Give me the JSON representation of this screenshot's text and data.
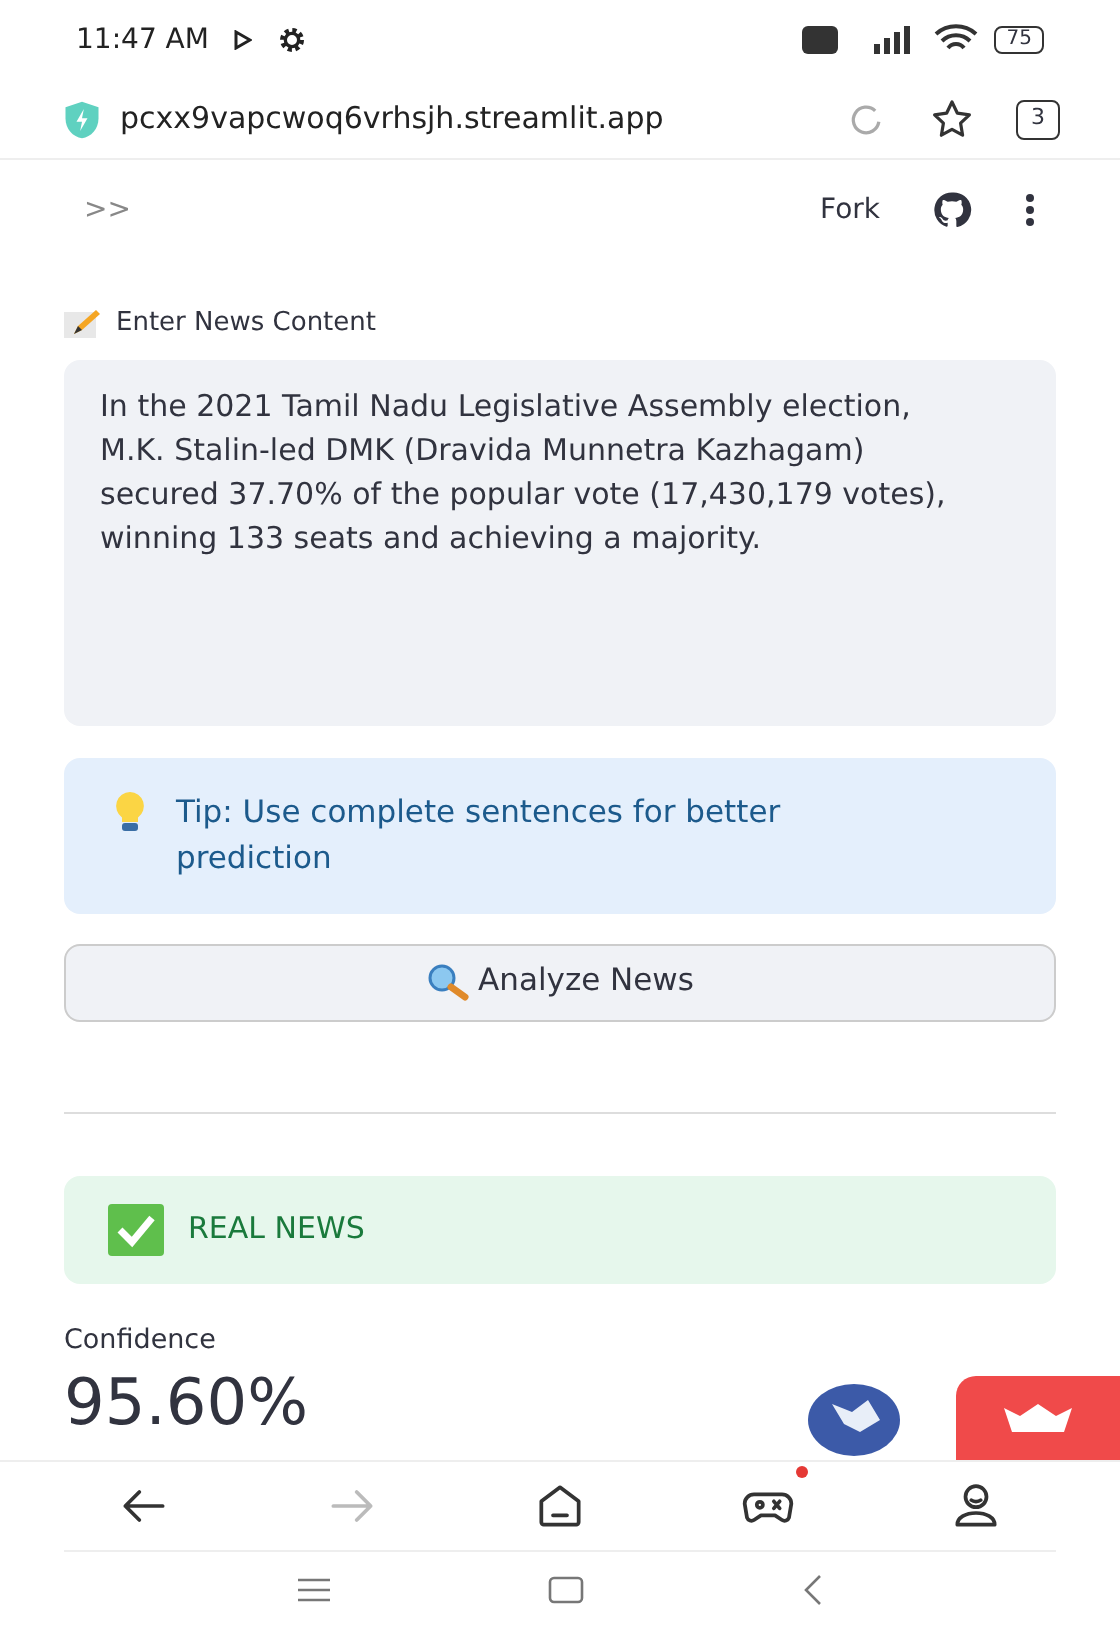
{
  "status_bar": {
    "time": "11:47 AM",
    "battery": "75"
  },
  "browser": {
    "url": "pcxx9vapcwoq6vrhsjh.streamlit.app",
    "tab_count": "3"
  },
  "app_header": {
    "expand": ">>",
    "fork": "Fork"
  },
  "input": {
    "label": "Enter News Content",
    "value": "In the 2021 Tamil Nadu Legislative Assembly election, M.K. Stalin-led DMK (Dravida Munnetra Kazhagam) secured 37.70% of the popular vote (17,430,179 votes), winning 133 seats and achieving a majority."
  },
  "tip": {
    "text": "Tip: Use complete sentences for better prediction"
  },
  "analyze_button": {
    "label": "Analyze News"
  },
  "result": {
    "kind": "success",
    "text": "REAL NEWS"
  },
  "metric": {
    "label": "Confidence",
    "value": "95.60%"
  },
  "browser_nav": [
    {
      "kind": "back",
      "disabled": false,
      "notification": false
    },
    {
      "kind": "forward",
      "disabled": true,
      "notification": false
    },
    {
      "kind": "home",
      "disabled": false,
      "notification": false
    },
    {
      "kind": "games",
      "disabled": false,
      "notification": true
    },
    {
      "kind": "profile",
      "disabled": false,
      "notification": false
    }
  ]
}
